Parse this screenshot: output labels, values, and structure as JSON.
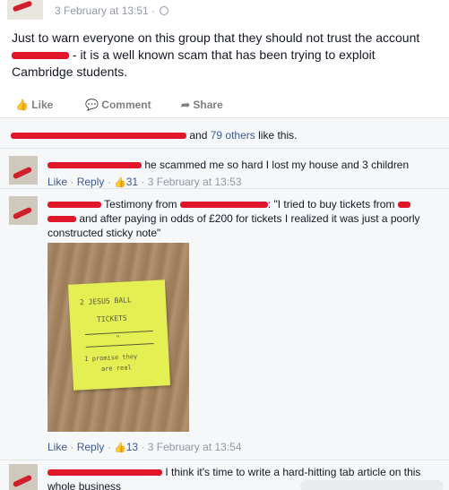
{
  "post": {
    "timestamp": "3 February at 13:51 ·",
    "text_before": "Just to warn everyone on this group that they should not trust the account",
    "text_after": " - it is a well known scam that has been trying to exploit Cambridge students."
  },
  "actions": {
    "like": "Like",
    "comment": "Comment",
    "share": "Share"
  },
  "likes": {
    "others": "and",
    "others_link": "79 others",
    "suffix": "like this."
  },
  "comments": [
    {
      "text": "he scammed me so hard I lost my house and 3 children",
      "like": "Like",
      "reply": "Reply",
      "likes": "31",
      "time": "3 February at 13:53"
    },
    {
      "text_1": "Testimony from",
      "text_2": ": \"I tried to buy tickets from",
      "text_3": "and after paying in odds of £200 for tickets I realized it was just a poorly constructed sticky note\"",
      "photo_lines": [
        "2 JESUS BALL",
        "TICKETS",
        "\"",
        "I promise they",
        "are real"
      ],
      "like": "Like",
      "reply": "Reply",
      "likes": "13",
      "time": "3 February at 13:54"
    },
    {
      "text": "I think it's time to write a hard-hitting tab article on this whole business"
    }
  ],
  "colors": {
    "link": "#3b5998",
    "meta": "#9197a3",
    "redaction": "#e0162b",
    "ufi_bg": "#f6f7f9"
  }
}
